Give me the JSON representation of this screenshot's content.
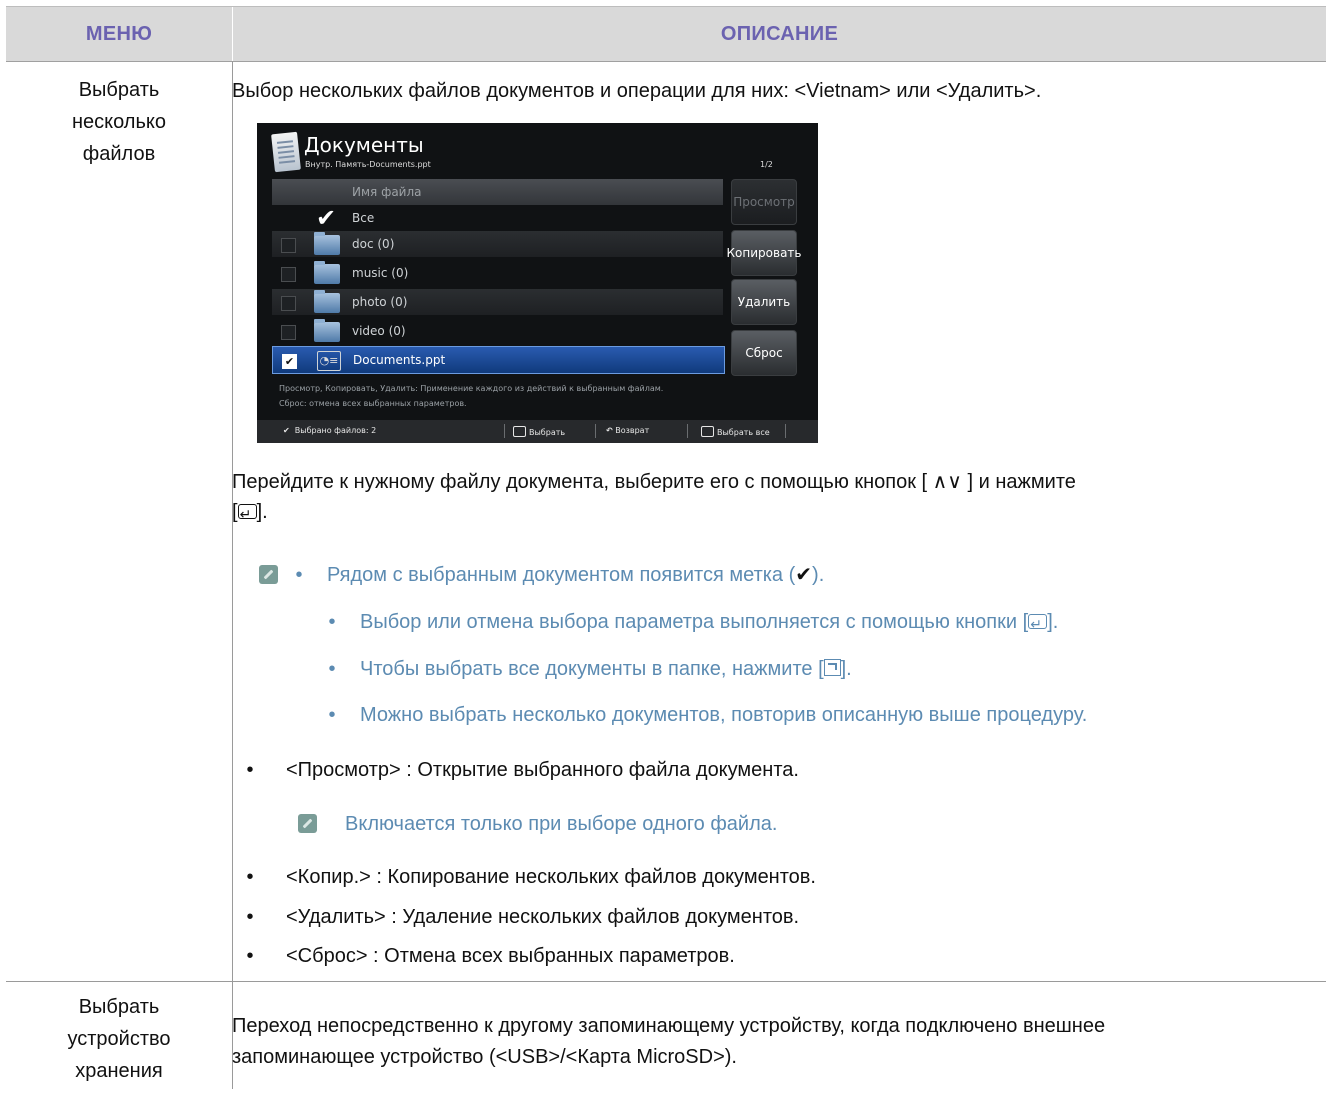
{
  "header": {
    "col_menu": "МЕНЮ",
    "col_desc": "ОПИСАНИЕ"
  },
  "rows": [
    {
      "menu": [
        "Выбрать",
        "несколько",
        "файлов"
      ],
      "intro": "Выбор нескольких файлов документов и операции для них: <Vietnam> или <Удалить>.",
      "screenshot": {
        "title": "Документы",
        "path": "Внутр. Память-Documents.ppt",
        "page": "1/2",
        "list_header": "Имя файла",
        "items": [
          {
            "name": "Все",
            "checked": true,
            "icon": "checkmark-icon"
          },
          {
            "name": "doc (0)",
            "checked": false,
            "icon": "folder-icon"
          },
          {
            "name": "music (0)",
            "checked": false,
            "icon": "folder-icon"
          },
          {
            "name": "photo (0)",
            "checked": false,
            "icon": "folder-icon"
          },
          {
            "name": "video (0)",
            "checked": false,
            "icon": "folder-icon"
          },
          {
            "name": "Documents.ppt",
            "checked": true,
            "icon": "ppt-file-icon"
          }
        ],
        "buttons": [
          "Просмотр",
          "Копировать",
          "Удалить",
          "Сброс"
        ],
        "help_line1": "Просмотр, Копировать, Удалить: Применение каждого из действий к выбранным файлам.",
        "help_line2": "Сброс: отмена всех выбранных параметров.",
        "footer": {
          "selected_count": "Выбрано файлов: 2",
          "select": "Выбрать",
          "back": "Возврат",
          "select_all": "Выбрать все"
        },
        "colors": {
          "background": "#101214",
          "selection": "#1f4f9e"
        }
      },
      "instruction_a": "Перейдите к нужному файлу документа, выберите его с помощью кнопок [ ",
      "instruction_arrows": "∧∨",
      "instruction_b": " ] и нажмите",
      "instruction_c1": "[",
      "instruction_c2": "].",
      "notes": {
        "n1a": "Рядом с выбранным документом появится метка (",
        "n1b": ").",
        "n2a": "Выбор или отмена выбора параметра выполняется с помощью кнопки [",
        "n2b": "].",
        "n3a": "Чтобы выбрать все документы в папке, нажмите [",
        "n3b": "].",
        "n4": "Можно выбрать несколько документов, повторив описанную выше процедуру."
      },
      "bullets": {
        "b1": "<Просмотр> : Открытие выбранного файла документа.",
        "b1_note": "Включается только при выборе одного файла.",
        "b2": "<Копир.> : Копирование нескольких файлов документов.",
        "b3": "<Удалить> : Удаление нескольких файлов документов.",
        "b4": "<Сброс> : Отмена всех выбранных параметров."
      }
    },
    {
      "menu": [
        "Выбрать",
        "устройство",
        "хранения"
      ],
      "line1": "Переход непосредственно к другому запоминающему устройству, когда подключено внешнее",
      "line2": "запоминающее устройство (<USB>/<Карта MicroSD>)."
    }
  ],
  "colors": {
    "header_bg": "#d9d9d9",
    "header_text": "#6b62b0",
    "note_text": "#5c8bb2",
    "note_icon": "#7a9c97"
  }
}
